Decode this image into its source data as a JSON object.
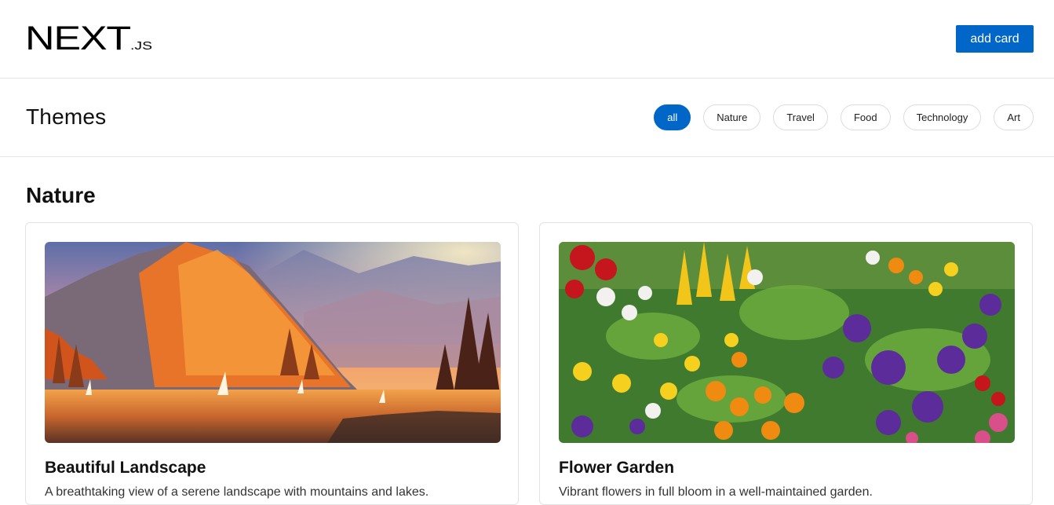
{
  "header": {
    "logo": {
      "text": "NEXT",
      "suffix": ".JS"
    },
    "add_card_label": "add card"
  },
  "themes": {
    "title": "Themes",
    "filters": [
      {
        "label": "all",
        "active": true
      },
      {
        "label": "Nature",
        "active": false
      },
      {
        "label": "Travel",
        "active": false
      },
      {
        "label": "Food",
        "active": false
      },
      {
        "label": "Technology",
        "active": false
      },
      {
        "label": "Art",
        "active": false
      }
    ]
  },
  "section": {
    "title": "Nature",
    "cards": [
      {
        "title": "Beautiful Landscape",
        "description": "A breathtaking view of a serene landscape with mountains and lakes."
      },
      {
        "title": "Flower Garden",
        "description": "Vibrant flowers in full bloom in a well-maintained garden."
      }
    ]
  },
  "colors": {
    "accent": "#0066c7",
    "border": "#e5e5e5",
    "text": "#111111"
  }
}
